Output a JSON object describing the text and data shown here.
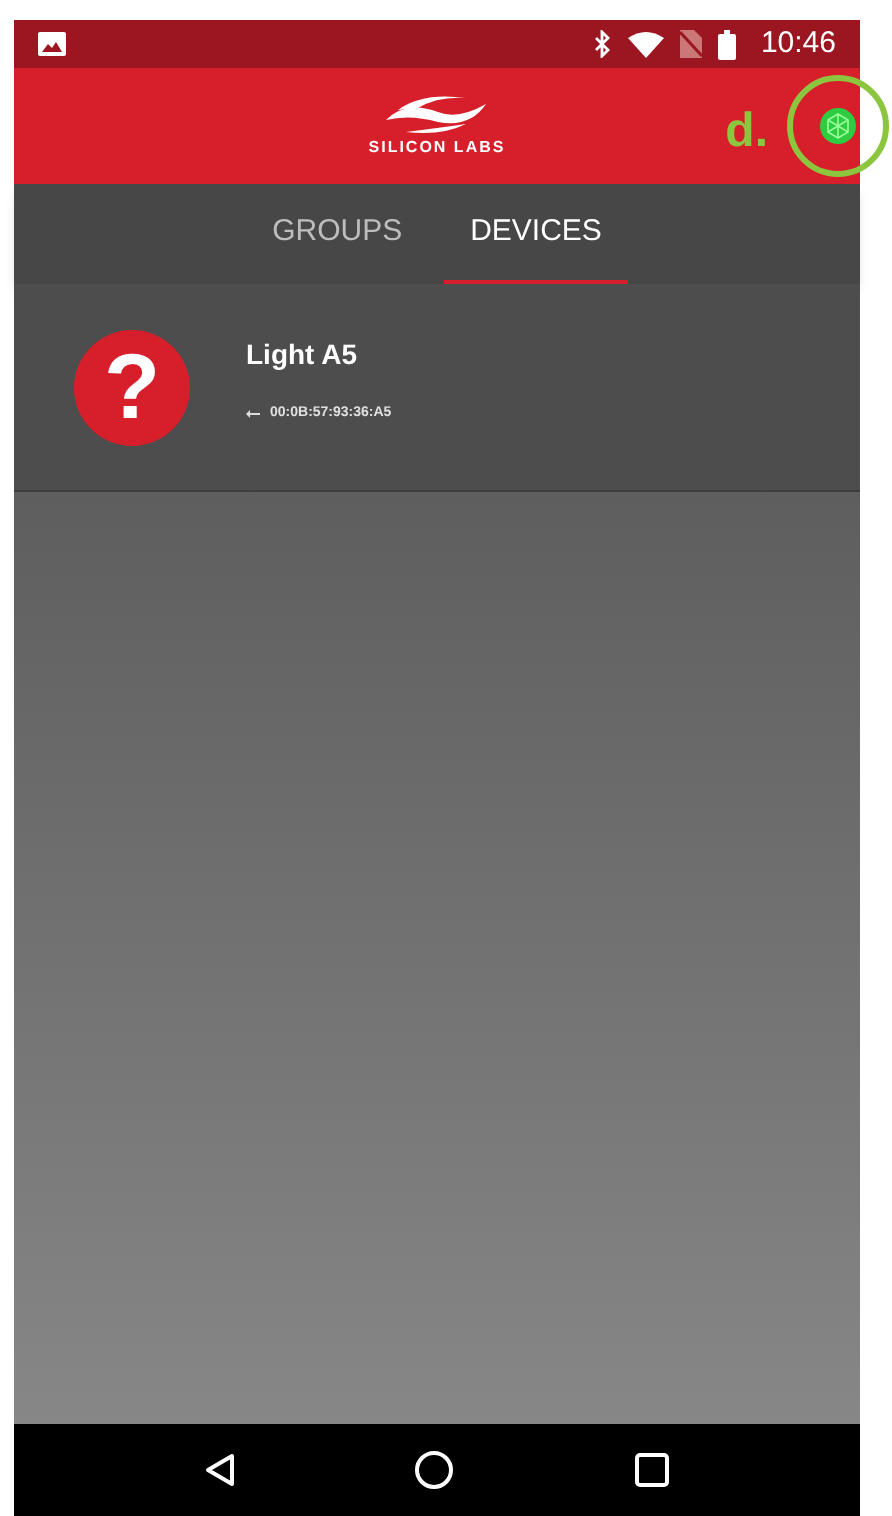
{
  "status_bar": {
    "time": "10:46"
  },
  "app_bar": {
    "logo_text": "SILICON LABS"
  },
  "annotation": {
    "label": "d."
  },
  "tabs": [
    {
      "label": "GROUPS",
      "selected": false
    },
    {
      "label": "DEVICES",
      "selected": true
    }
  ],
  "devices": [
    {
      "name": "Light A5",
      "address": "00:0B:57:93:36:A5",
      "icon_text": "?"
    }
  ]
}
